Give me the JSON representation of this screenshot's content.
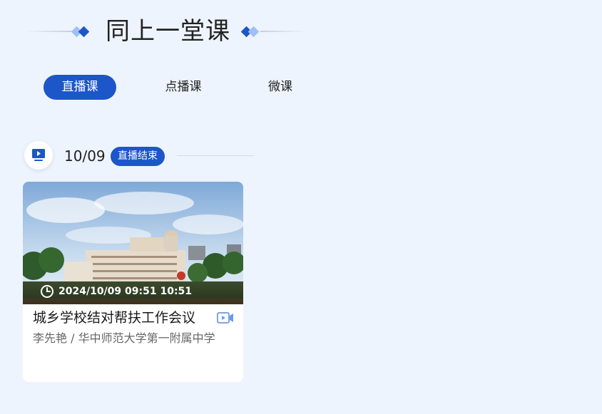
{
  "section": {
    "title": "同上一堂课"
  },
  "tabs": [
    {
      "label": "直播课",
      "active": true
    },
    {
      "label": "点播课",
      "active": false
    },
    {
      "label": "微课",
      "active": false
    }
  ],
  "group": {
    "date": "10/09",
    "status": "直播结束",
    "icon": "tv-play-icon"
  },
  "card": {
    "time": "2024/10/09 09:51 10:51",
    "title": "城乡学校结对帮扶工作会议",
    "subtitle": "李先艳 / 华中师范大学第一附属中学",
    "type_icon": "video-icon",
    "time_icon": "clock-icon"
  },
  "colors": {
    "accent": "#1d56c9",
    "background": "#eef4fd",
    "card": "#ffffff",
    "subtitle": "#666666"
  }
}
